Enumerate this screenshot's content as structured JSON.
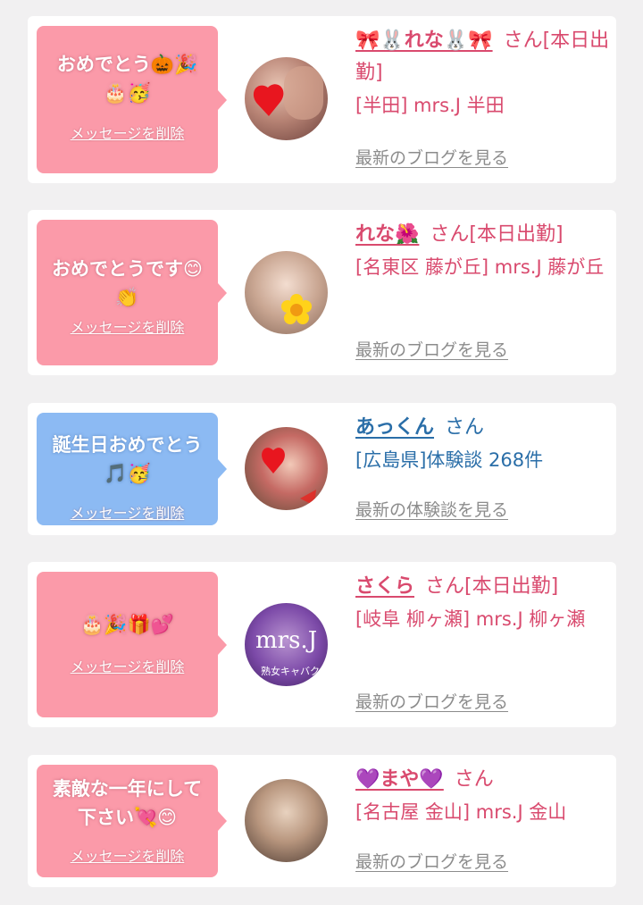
{
  "delete_label": "メッセージを削除",
  "colors": {
    "pink_bubble": "#fb9aa9",
    "blue_bubble": "#8cbaf3",
    "name_pink": "#d94a6e",
    "name_blue": "#2a6ea8",
    "link_gray": "#8c8c8c"
  },
  "cards": [
    {
      "message": "おめでとう🎃🎉\n🎂🥳",
      "name": "🎀🐰れな🐰🎀",
      "honorific": "さん[本日出勤]",
      "shop": "[半田] mrs.J 半田",
      "link": "最新のブログを見る"
    },
    {
      "message": "おめでとうです😊\n👏",
      "name": "れな🌺",
      "honorific": "さん[本日出勤]",
      "shop": "[名東区 藤が丘] mrs.J 藤が丘",
      "link": "最新のブログを見る"
    },
    {
      "message": "誕生日おめでとう\n🎵🥳",
      "name": "あっくん",
      "honorific": "さん",
      "shop": "[広島県]体験談 268件",
      "link": "最新の体験談を見る"
    },
    {
      "message": "🎂🎉🎁💕",
      "name": "さくら",
      "honorific": "さん[本日出勤]",
      "shop": "[岐阜 柳ヶ瀬] mrs.J 柳ヶ瀬",
      "link": "最新のブログを見る",
      "avatar_logo": "mrs.J",
      "avatar_sub": "熟女キャバクラ"
    },
    {
      "message": "素敵な一年にして\n下さい💘😊",
      "name": "💜まや💜",
      "honorific": "さん",
      "shop": "[名古屋 金山] mrs.J 金山",
      "link": "最新のブログを見る"
    }
  ]
}
